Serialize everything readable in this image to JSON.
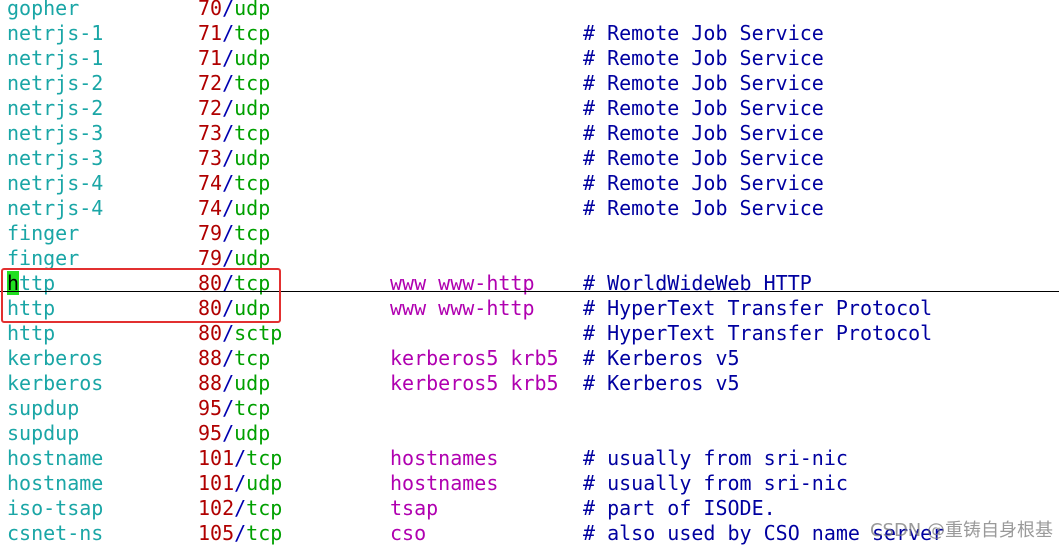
{
  "lines": [
    {
      "service": "gopher",
      "port": "70",
      "proto": "udp",
      "aliases": "",
      "comment": ""
    },
    {
      "service": "netrjs-1",
      "port": "71",
      "proto": "tcp",
      "aliases": "",
      "comment": "# Remote Job Service"
    },
    {
      "service": "netrjs-1",
      "port": "71",
      "proto": "udp",
      "aliases": "",
      "comment": "# Remote Job Service"
    },
    {
      "service": "netrjs-2",
      "port": "72",
      "proto": "tcp",
      "aliases": "",
      "comment": "# Remote Job Service"
    },
    {
      "service": "netrjs-2",
      "port": "72",
      "proto": "udp",
      "aliases": "",
      "comment": "# Remote Job Service"
    },
    {
      "service": "netrjs-3",
      "port": "73",
      "proto": "tcp",
      "aliases": "",
      "comment": "# Remote Job Service"
    },
    {
      "service": "netrjs-3",
      "port": "73",
      "proto": "udp",
      "aliases": "",
      "comment": "# Remote Job Service"
    },
    {
      "service": "netrjs-4",
      "port": "74",
      "proto": "tcp",
      "aliases": "",
      "comment": "# Remote Job Service"
    },
    {
      "service": "netrjs-4",
      "port": "74",
      "proto": "udp",
      "aliases": "",
      "comment": "# Remote Job Service"
    },
    {
      "service": "finger",
      "port": "79",
      "proto": "tcp",
      "aliases": "",
      "comment": ""
    },
    {
      "service": "finger",
      "port": "79",
      "proto": "udp",
      "aliases": "",
      "comment": ""
    },
    {
      "service": "http",
      "port": "80",
      "proto": "tcp",
      "aliases": "www www-http",
      "comment": "# WorldWideWeb HTTP"
    },
    {
      "service": "http",
      "port": "80",
      "proto": "udp",
      "aliases": "www www-http",
      "comment": "# HyperText Transfer Protocol"
    },
    {
      "service": "http",
      "port": "80",
      "proto": "sctp",
      "aliases": "",
      "comment": "# HyperText Transfer Protocol"
    },
    {
      "service": "kerberos",
      "port": "88",
      "proto": "tcp",
      "aliases": "kerberos5 krb5",
      "comment": "# Kerberos v5"
    },
    {
      "service": "kerberos",
      "port": "88",
      "proto": "udp",
      "aliases": "kerberos5 krb5",
      "comment": "# Kerberos v5"
    },
    {
      "service": "supdup",
      "port": "95",
      "proto": "tcp",
      "aliases": "",
      "comment": ""
    },
    {
      "service": "supdup",
      "port": "95",
      "proto": "udp",
      "aliases": "",
      "comment": ""
    },
    {
      "service": "hostname",
      "port": "101",
      "proto": "tcp",
      "aliases": "hostnames",
      "comment": "# usually from sri-nic"
    },
    {
      "service": "hostname",
      "port": "101",
      "proto": "udp",
      "aliases": "hostnames",
      "comment": "# usually from sri-nic"
    },
    {
      "service": "iso-tsap",
      "port": "102",
      "proto": "tcp",
      "aliases": "tsap",
      "comment": "# part of ISODE."
    },
    {
      "service": "csnet-ns",
      "port": "105",
      "proto": "tcp",
      "aliases": "cso",
      "comment": "# also used by CSO name server"
    }
  ],
  "cursor": {
    "line": 11,
    "char": "h",
    "rest": "ttp"
  },
  "watermark": "CSDN @重铸自身根基",
  "colors": {
    "service": "#1aa6a6",
    "port": "#b00000",
    "slash": "#0000b0",
    "protocol": "#00a000",
    "aliases": "#b000b0",
    "comment": "#0000a0",
    "cursor": "#20e020",
    "highlight_box": "#e23030"
  }
}
